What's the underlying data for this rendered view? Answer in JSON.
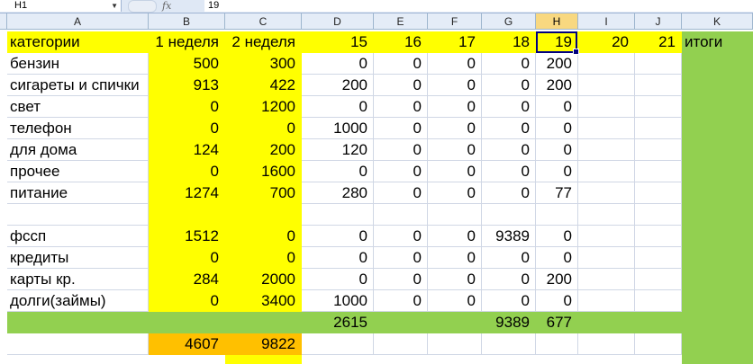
{
  "formula_bar": {
    "name_box": "H1",
    "fx_icon": "fx",
    "content": "19"
  },
  "columns": [
    "A",
    "B",
    "C",
    "D",
    "E",
    "F",
    "G",
    "H",
    "I",
    "J",
    "K"
  ],
  "selected_column": "H",
  "header_row": [
    "категории",
    "1 неделя",
    "2 неделя",
    "15",
    "16",
    "17",
    "18",
    "19",
    "20",
    "21",
    "итоги"
  ],
  "rows": [
    [
      "бензин",
      "500",
      "300",
      "0",
      "0",
      "0",
      "0",
      "200"
    ],
    [
      "сигареты и спички",
      "913",
      "422",
      "200",
      "0",
      "0",
      "0",
      "200"
    ],
    [
      "свет",
      "0",
      "1200",
      "0",
      "0",
      "0",
      "0",
      "0"
    ],
    [
      "телефон",
      "0",
      "0",
      "1000",
      "0",
      "0",
      "0",
      "0"
    ],
    [
      "для дома",
      "124",
      "200",
      "120",
      "0",
      "0",
      "0",
      "0"
    ],
    [
      "прочее",
      "0",
      "1600",
      "0",
      "0",
      "0",
      "0",
      "0"
    ],
    [
      "питание",
      "1274",
      "700",
      "280",
      "0",
      "0",
      "0",
      "77"
    ],
    [
      "",
      "",
      "",
      "",
      "",
      "",
      "",
      ""
    ],
    [
      "фссп",
      "1512",
      "0",
      "0",
      "0",
      "0",
      "9389",
      "0"
    ],
    [
      "кредиты",
      "0",
      "0",
      "0",
      "0",
      "0",
      "0",
      "0"
    ],
    [
      "карты кр.",
      "284",
      "2000",
      "0",
      "0",
      "0",
      "0",
      "200"
    ],
    [
      "долги(займы)",
      "0",
      "3400",
      "1000",
      "0",
      "0",
      "0",
      "0"
    ]
  ],
  "totals_row": [
    "",
    "",
    "",
    "2615",
    "",
    "",
    "9389",
    "677",
    "",
    "",
    ""
  ],
  "sum_row": [
    "",
    "4607",
    "9822"
  ],
  "colors": {
    "yellow": "#ffff00",
    "green": "#92d050",
    "orange": "#ffc000",
    "selection": "#000080"
  }
}
